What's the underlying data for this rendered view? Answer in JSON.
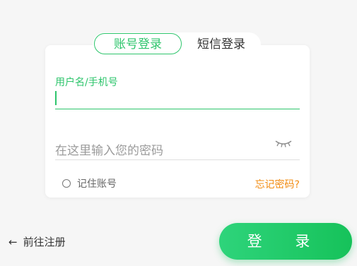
{
  "tabs": {
    "account": "账号登录",
    "sms": "短信登录"
  },
  "form": {
    "username_label": "用户名/手机号",
    "password_placeholder": "在这里输入您的密码",
    "remember_label": "记住账号",
    "forgot_label": "忘记密码?"
  },
  "footer": {
    "register_label": "前往注册",
    "login_label": "登 录"
  },
  "icons": {
    "eye": "eye-closed-icon",
    "back": "arrow-left-icon"
  },
  "colors": {
    "accent": "#2ec56c",
    "link": "#f28c12"
  }
}
